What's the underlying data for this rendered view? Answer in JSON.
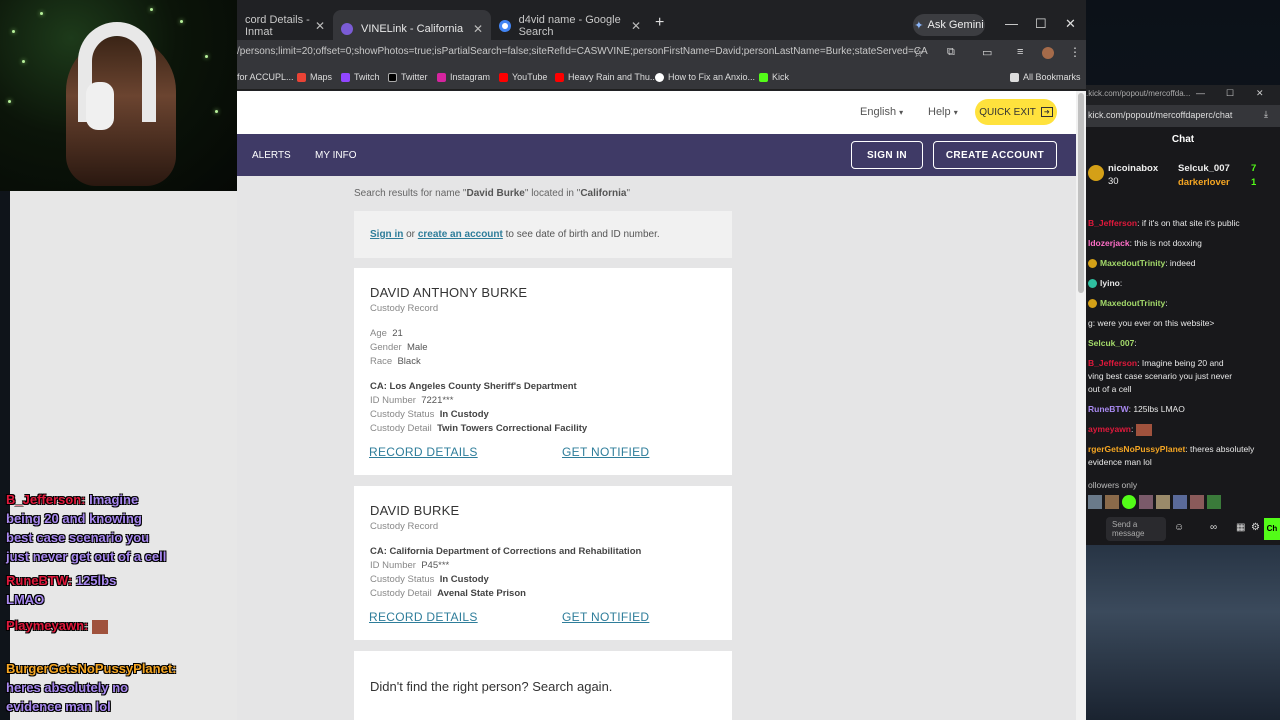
{
  "overlay_chat": [
    {
      "name": "B_Jefferson:",
      "text": "Imagine"
    },
    {
      "name": "",
      "text": "being 20 and knowing"
    },
    {
      "name": "",
      "text": "best case scenario you"
    },
    {
      "name": "",
      "text": "just never get out of a cell"
    },
    {
      "name": "RuneBTW:",
      "text": "125lbs"
    },
    {
      "name": "",
      "text": "LMAO"
    },
    {
      "name": "Playmeyawn:",
      "text": ""
    },
    {
      "name": "BurgerGetsNoPussyPlanet:",
      "text": ""
    },
    {
      "name": "",
      "text": "heres absolutely no"
    },
    {
      "name": "",
      "text": "evidence man lol"
    }
  ],
  "browser": {
    "tabs": [
      {
        "label": "cord Details - Inmat"
      },
      {
        "label": "VINELink - California"
      },
      {
        "label": "d4vid name - Google Search"
      }
    ],
    "new_tab": "+",
    "ask_gemini": "Ask Gemini",
    "url": "/persons;limit=20;offset=0;showPhotos=true;isPartialSearch=false;siteRefId=CASWVINE;personFirstName=David;personLastName=Burke;stateServed=CA",
    "bookmarks": [
      "for ACCUPL...",
      "Maps",
      "Twitch",
      "Twitter",
      "Instagram",
      "YouTube",
      "Heavy Rain and Thu...",
      "How to Fix an Anxio...",
      "Kick"
    ],
    "all_bookmarks": "All Bookmarks"
  },
  "site": {
    "language": "English",
    "help": "Help",
    "quick_exit": "QUICK EXIT",
    "nav": {
      "alerts": "ALERTS",
      "my_info": "MY INFO",
      "sign_in": "SIGN IN",
      "create_account": "CREATE ACCOUNT"
    },
    "results": {
      "prefix": "Search results for name \"",
      "name": "David Burke",
      "middle": "\" located in \"",
      "state": "California",
      "suffix": "\""
    },
    "signin_prompt": {
      "sign_in": "Sign in",
      "or": "or",
      "create": "create an account",
      "rest": "to see date of birth and ID number."
    },
    "records": [
      {
        "name": "DAVID ANTHONY BURKE",
        "type": "Custody Record",
        "age_label": "Age",
        "age": "21",
        "gender_label": "Gender",
        "gender": "Male",
        "race_label": "Race",
        "race": "Black",
        "agency": "CA: Los Angeles County Sheriff's Department",
        "id_label": "ID Number",
        "id": "7221***",
        "status_label": "Custody Status",
        "status": "In Custody",
        "detail_label": "Custody Detail",
        "detail": "Twin Towers Correctional Facility",
        "record_details": "RECORD DETAILS",
        "get_notified": "GET NOTIFIED"
      },
      {
        "name": "DAVID BURKE",
        "type": "Custody Record",
        "agency": "CA: California Department of Corrections and Rehabilitation",
        "id_label": "ID Number",
        "id": "P45***",
        "status_label": "Custody Status",
        "status": "In Custody",
        "detail_label": "Custody Detail",
        "detail": "Avenal State Prison",
        "record_details": "RECORD DETAILS",
        "get_notified": "GET NOTIFIED"
      }
    ],
    "search_again": "Didn't find the right person? Search again."
  },
  "chat_popout": {
    "url": "kick.com/popout/mercoffdaperc/chat",
    "url_top": ".kick.com/popout/mercoffda...",
    "title": "Chat",
    "leaderboard": [
      {
        "name": "nicoinabox",
        "value": "30"
      },
      {
        "name": "Selcuk_007",
        "value": "7"
      },
      {
        "name": "darkerlover",
        "value": "1"
      }
    ],
    "messages": [
      {
        "user": "B_Jefferson",
        "text": ": if it's on that site it's public"
      },
      {
        "user": "ldozerjack",
        "text": ": this is not doxxing"
      },
      {
        "user": "MaxedoutTrinity",
        "text": ": indeed"
      },
      {
        "user": "lyino",
        "text": ":"
      },
      {
        "user": "MaxedoutTrinity",
        "text": ":"
      },
      {
        "user": "",
        "text": "g: were you ever on this website>"
      },
      {
        "user": "Selcuk_007",
        "text": ":"
      },
      {
        "user": "B_Jefferson",
        "text": ": Imagine being 20 and"
      },
      {
        "user": "",
        "text": "ving best case scenario you just never"
      },
      {
        "user": "",
        "text": "out of a cell"
      },
      {
        "user": "RuneBTW",
        "text": ": 125lbs LMAO"
      },
      {
        "user": "aymeyawn",
        "text": ":"
      },
      {
        "user": "rgerGetsNoPussyPlanet",
        "text": ": theres absolutely"
      },
      {
        "user": "",
        "text": "evidence man lol"
      }
    ],
    "followers_only": "ollowers only",
    "input_placeholder": "Send a message",
    "send": "Ch"
  },
  "colors": {
    "nav": "#3f3a66",
    "quick_exit": "#ffe23d",
    "link": "#2e7d9a",
    "kick_green": "#53fc18"
  }
}
